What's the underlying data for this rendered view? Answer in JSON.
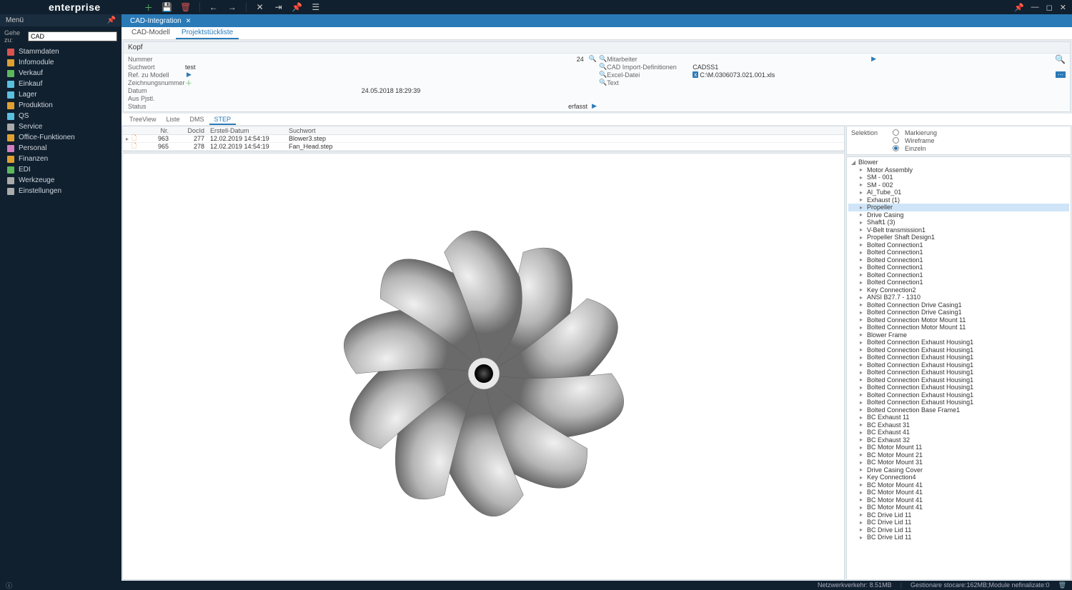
{
  "app": {
    "title": "enterprise"
  },
  "sidebar": {
    "menu_label": "Menü",
    "search_label": "Gehe zu:",
    "search_value": "CAD",
    "items": [
      {
        "label": "Stammdaten",
        "color": "#d9534f"
      },
      {
        "label": "Infomodule",
        "color": "#e0a030"
      },
      {
        "label": "Verkauf",
        "color": "#5cb85c"
      },
      {
        "label": "Einkauf",
        "color": "#5bc0de"
      },
      {
        "label": "Lager",
        "color": "#5bc0de"
      },
      {
        "label": "Produktion",
        "color": "#e0a030"
      },
      {
        "label": "QS",
        "color": "#5bc0de"
      },
      {
        "label": "Service",
        "color": "#aaa"
      },
      {
        "label": "Office-Funktionen",
        "color": "#e0a030"
      },
      {
        "label": "Personal",
        "color": "#d080c0"
      },
      {
        "label": "Finanzen",
        "color": "#e0a030"
      },
      {
        "label": "EDI",
        "color": "#5cb85c"
      },
      {
        "label": "Werkzeuge",
        "color": "#aaa"
      },
      {
        "label": "Einstellungen",
        "color": "#aaa"
      }
    ]
  },
  "main_tab": {
    "title": "CAD-Integration"
  },
  "subtabs": [
    {
      "label": "CAD-Modell",
      "active": false
    },
    {
      "label": "Projektstückliste",
      "active": true
    }
  ],
  "form": {
    "header": "Kopf",
    "nummer_label": "Nummer",
    "nummer_value": "24",
    "suchwort_label": "Suchwort",
    "suchwort_value": "test",
    "ref_label": "Ref. zu Modell",
    "zeich_label": "Zeichnungsnummer",
    "datum_label": "Datum",
    "datum_value": "24.05.2018 18:29:39",
    "auspjstl_label": "Aus Pjstl.",
    "status_label": "Status",
    "status_value": "erfasst",
    "mitarbeiter_label": "Mitarbeiter",
    "caddef_label": "CAD Import-Definitionen",
    "caddef_value": "CADSS1",
    "excel_label": "Excel-Datei",
    "excel_value": "C:\\M.0306073.021.001.xls",
    "text_label": "Text"
  },
  "inner_tabs": [
    {
      "label": "TreeView",
      "active": false
    },
    {
      "label": "Liste",
      "active": false
    },
    {
      "label": "DMS",
      "active": false
    },
    {
      "label": "STEP",
      "active": true
    }
  ],
  "table": {
    "columns": {
      "nr": "Nr.",
      "docid": "DocId",
      "erstell": "Erstell-Datum",
      "suchwort": "Suchwort"
    },
    "rows": [
      {
        "nr": "963",
        "docid": "277",
        "erstell": "12.02.2019 14:54:19",
        "suchwort": "Blower3.step",
        "pointer": true
      },
      {
        "nr": "965",
        "docid": "278",
        "erstell": "12.02.2019 14:54:19",
        "suchwort": "Fan_Head.step",
        "pointer": false
      }
    ]
  },
  "selection": {
    "label": "Selektion",
    "options": [
      {
        "label": "Markierung",
        "checked": false
      },
      {
        "label": "Wireframe",
        "checked": false
      },
      {
        "label": "Einzeln",
        "checked": true
      }
    ]
  },
  "tree": {
    "root": "Blower",
    "selected_index": 5,
    "items": [
      "Motor Assembly",
      "SM - 001",
      "SM - 002",
      "Al_Tube_01",
      "Exhaust (1)",
      "Propeller",
      "Drive Casing",
      "Shaft1 (3)",
      "V-Belt transmission1",
      "Propeller Shaft Design1",
      "Bolted Connection1",
      "Bolted Connection1",
      "Bolted Connection1",
      "Bolted Connection1",
      "Bolted Connection1",
      "Bolted Connection1",
      "Key Connection2",
      "ANSI B27.7 - 1310",
      "Bolted Connection Drive Casing1",
      "Bolted Connection Drive Casing1",
      "Bolted Connection Motor Mount 11",
      "Bolted Connection Motor Mount 11",
      "Blower Frame",
      "Bolted Connection Exhaust Housing1",
      "Bolted Connection Exhaust Housing1",
      "Bolted Connection Exhaust Housing1",
      "Bolted Connection Exhaust Housing1",
      "Bolted Connection Exhaust Housing1",
      "Bolted Connection Exhaust Housing1",
      "Bolted Connection Exhaust Housing1",
      "Bolted Connection Exhaust Housing1",
      "Bolted Connection Exhaust Housing1",
      "Bolted Connection Base Frame1",
      "BC Exhaust 11",
      "BC Exhaust 31",
      "BC Exhaust 41",
      "BC Exhaust 32",
      "BC Motor Mount 11",
      "BC Motor Mount 21",
      "BC Motor Mount 31",
      "Drive Casing Cover",
      "Key Connection4",
      "BC Motor Mount 41",
      "BC Motor Mount 41",
      "BC Motor Mount 41",
      "BC Motor Mount 41",
      "BC Drive Lid 11",
      "BC Drive Lid 11",
      "BC Drive Lid 11",
      "BC Drive Lid 11"
    ]
  },
  "status": {
    "netz": "Netzwerkverkehr: 8.51MB",
    "stoc": "Gestionare stocare:162MB;Module nefinalizate:0"
  }
}
